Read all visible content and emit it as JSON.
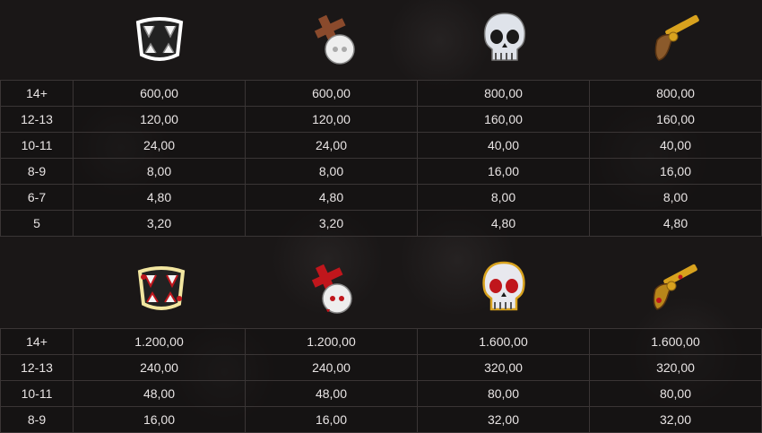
{
  "icons": {
    "top": [
      "fangs-icon",
      "cross-skull-icon",
      "skull-icon",
      "pistol-icon"
    ],
    "bottom": [
      "bloody-fangs-icon",
      "bloody-cross-skull-icon",
      "bloody-skull-icon",
      "bloody-pistol-icon"
    ]
  },
  "table_top": {
    "rows": [
      {
        "label": "14+",
        "values": [
          "600,00",
          "600,00",
          "800,00",
          "800,00"
        ]
      },
      {
        "label": "12-13",
        "values": [
          "120,00",
          "120,00",
          "160,00",
          "160,00"
        ]
      },
      {
        "label": "10-11",
        "values": [
          "24,00",
          "24,00",
          "40,00",
          "40,00"
        ]
      },
      {
        "label": "8-9",
        "values": [
          "8,00",
          "8,00",
          "16,00",
          "16,00"
        ]
      },
      {
        "label": "6-7",
        "values": [
          "4,80",
          "4,80",
          "8,00",
          "8,00"
        ]
      },
      {
        "label": "5",
        "values": [
          "3,20",
          "3,20",
          "4,80",
          "4,80"
        ]
      }
    ]
  },
  "table_bottom": {
    "rows": [
      {
        "label": "14+",
        "values": [
          "1.200,00",
          "1.200,00",
          "1.600,00",
          "1.600,00"
        ]
      },
      {
        "label": "12-13",
        "values": [
          "240,00",
          "240,00",
          "320,00",
          "320,00"
        ]
      },
      {
        "label": "10-11",
        "values": [
          "48,00",
          "48,00",
          "80,00",
          "80,00"
        ]
      },
      {
        "label": "8-9",
        "values": [
          "16,00",
          "16,00",
          "32,00",
          "32,00"
        ]
      }
    ]
  },
  "colors": {
    "background": "#1a1717",
    "cell_border": "#3a3535",
    "text": "#e8e4e4",
    "blood": "#c0161c",
    "gold": "#d8a21e"
  }
}
